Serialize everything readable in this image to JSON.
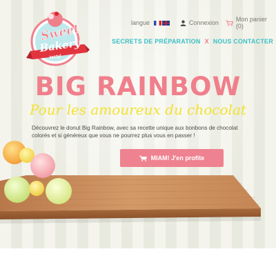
{
  "brand": {
    "logo_line1": "Sweet",
    "logo_line2": "Bakery",
    "logo_ribbon": "tasty!"
  },
  "topbar": {
    "language_label": "langue",
    "login_label": "Connexion",
    "cart_label": "Mon panier (0)"
  },
  "nav": {
    "items": [
      {
        "label": "SECRETS DE PRÉPARATION"
      },
      {
        "label": "NOUS CONTACTER"
      }
    ],
    "separator": "X"
  },
  "hero": {
    "title": "BIG RAINBOW",
    "subtitle": "Pour les amoureux du chocolat",
    "description": "Découvrez le donut Big Rainbow, avec sa recette unique aux bonbons de chocolat colorés et si généreux que vous ne pourrez plus vous en passer !",
    "cta_label": "MIAM! J'en profite"
  },
  "colors": {
    "accent_pink": "#f07f8c",
    "accent_teal": "#3cc0c6",
    "accent_yellow": "#f2e22f",
    "wood": "#c98a55"
  },
  "icons": {
    "user": "user-icon",
    "cart": "cart-icon",
    "cta": "cart-icon"
  }
}
